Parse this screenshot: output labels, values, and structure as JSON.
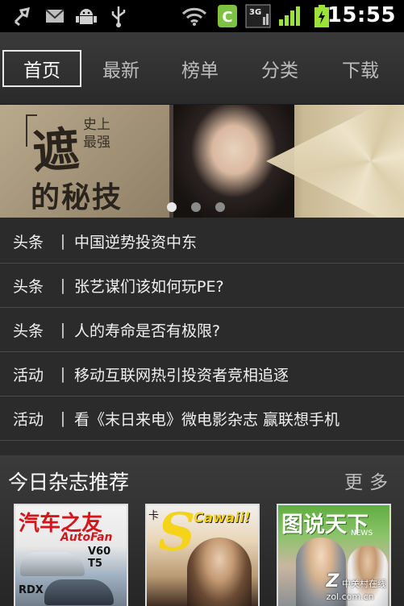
{
  "status_bar": {
    "time": "15:55",
    "icons": [
      "usb-debug-icon",
      "mail-icon",
      "android-icon",
      "usb-icon",
      "wifi-icon",
      "app-c-icon",
      "network-3g-icon",
      "signal-icon",
      "battery-charging-icon"
    ],
    "network_label": "3G",
    "app_icon_letter": "C"
  },
  "tabs": [
    {
      "label": "首页",
      "active": true
    },
    {
      "label": "最新",
      "active": false
    },
    {
      "label": "榜单",
      "active": false
    },
    {
      "label": "分类",
      "active": false
    },
    {
      "label": "下载",
      "active": false
    }
  ],
  "banner": {
    "headline_big": "遮",
    "headline_small": "史上最强",
    "headline_sub": "的秘技",
    "slides_count": 3,
    "active_slide": 1
  },
  "news": [
    {
      "category": "头条",
      "separator": "|",
      "title": "中国逆势投资中东"
    },
    {
      "category": "头条",
      "separator": "|",
      "title": "张艺谋们该如何玩PE?"
    },
    {
      "category": "头条",
      "separator": "|",
      "title": "人的寿命是否有极限?"
    },
    {
      "category": "活动",
      "separator": "|",
      "title": "移动互联网热引投资者竞相追逐"
    },
    {
      "category": "活动",
      "separator": "|",
      "title": "看《末日来电》微电影杂志  赢联想手机"
    }
  ],
  "magazines_section": {
    "title": "今日杂志推荐",
    "more_label": "更多",
    "items": [
      {
        "name": "汽车之友",
        "subtitle": "AutoFan",
        "model": "V60 T5",
        "sub_model": "RDX"
      },
      {
        "name": "Cawaii!",
        "letter": "S",
        "prefix": "卡"
      },
      {
        "name": "图说天下",
        "badge": "NEWS"
      }
    ],
    "watermark": "中关村在线",
    "watermark_url": "zol.com.cn"
  },
  "colors": {
    "background": "#2b2b2b",
    "status_bar": "#000000",
    "active_tab_border": "#e8e8e8",
    "mag1_title": "#d4161c",
    "mag2_title": "#f5d31a"
  }
}
